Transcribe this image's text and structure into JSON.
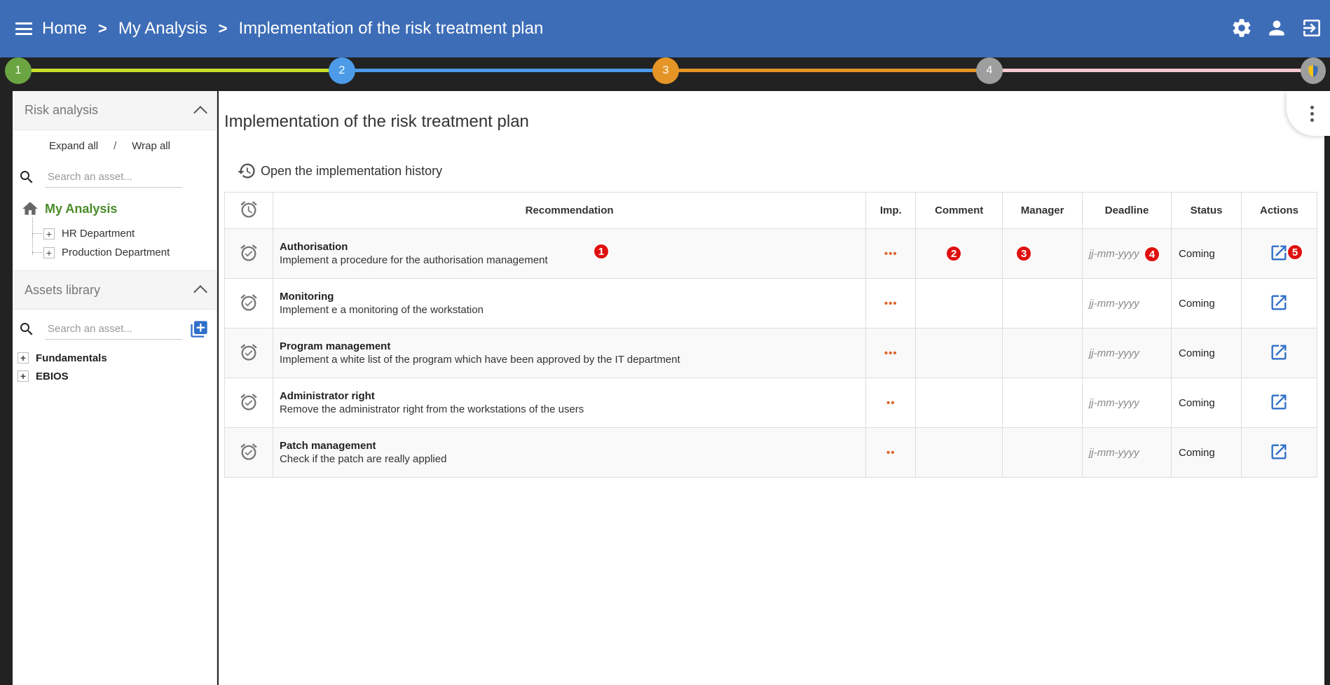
{
  "header": {
    "breadcrumbs": [
      "Home",
      "My Analysis",
      "Implementation of the risk treatment plan"
    ],
    "sep": ">"
  },
  "stepper": {
    "steps": [
      "1",
      "2",
      "3",
      "4"
    ],
    "colors": [
      "#6aa542",
      "#4d9be8",
      "#e49526",
      "#9e9e9e"
    ],
    "segment_colors": [
      "#c6e02a",
      "#4d9be8",
      "#e49526",
      "#f4c6cf"
    ]
  },
  "sidebar": {
    "risk_title": "Risk analysis",
    "expand_all": "Expand all",
    "slash": "/",
    "wrap_all": "Wrap all",
    "search_placeholder": "Search an asset...",
    "root": "My Analysis",
    "departments": [
      "HR Department",
      "Production Department"
    ],
    "library_title": "Assets library",
    "library_search_placeholder": "Search an asset...",
    "libraries": [
      "Fundamentals",
      "EBIOS"
    ]
  },
  "main": {
    "title": "Implementation of the risk treatment plan",
    "history_label": "Open the implementation history",
    "columns": {
      "recommendation": "Recommendation",
      "imp": "Imp.",
      "comment": "Comment",
      "manager": "Manager",
      "deadline": "Deadline",
      "status": "Status",
      "actions": "Actions"
    },
    "rows": [
      {
        "title": "Authorisation",
        "desc": "Implement a procedure for the authorisation management",
        "imp": "•••",
        "deadline": "jj-mm-yyyy",
        "status": "Coming"
      },
      {
        "title": "Monitoring",
        "desc": "Implement e a monitoring of the workstation",
        "imp": "•••",
        "deadline": "jj-mm-yyyy",
        "status": "Coming"
      },
      {
        "title": "Program management",
        "desc": "Implement a white list of the program which have been approved by the IT department",
        "imp": "•••",
        "deadline": "jj-mm-yyyy",
        "status": "Coming"
      },
      {
        "title": "Administrator right",
        "desc": "Remove the administrator right from the workstations of the users",
        "imp": "••",
        "deadline": "jj-mm-yyyy",
        "status": "Coming"
      },
      {
        "title": "Patch management",
        "desc": "Check if the patch are really applied",
        "imp": "••",
        "deadline": "jj-mm-yyyy",
        "status": "Coming"
      }
    ],
    "badges": [
      "1",
      "2",
      "3",
      "4",
      "5"
    ]
  }
}
